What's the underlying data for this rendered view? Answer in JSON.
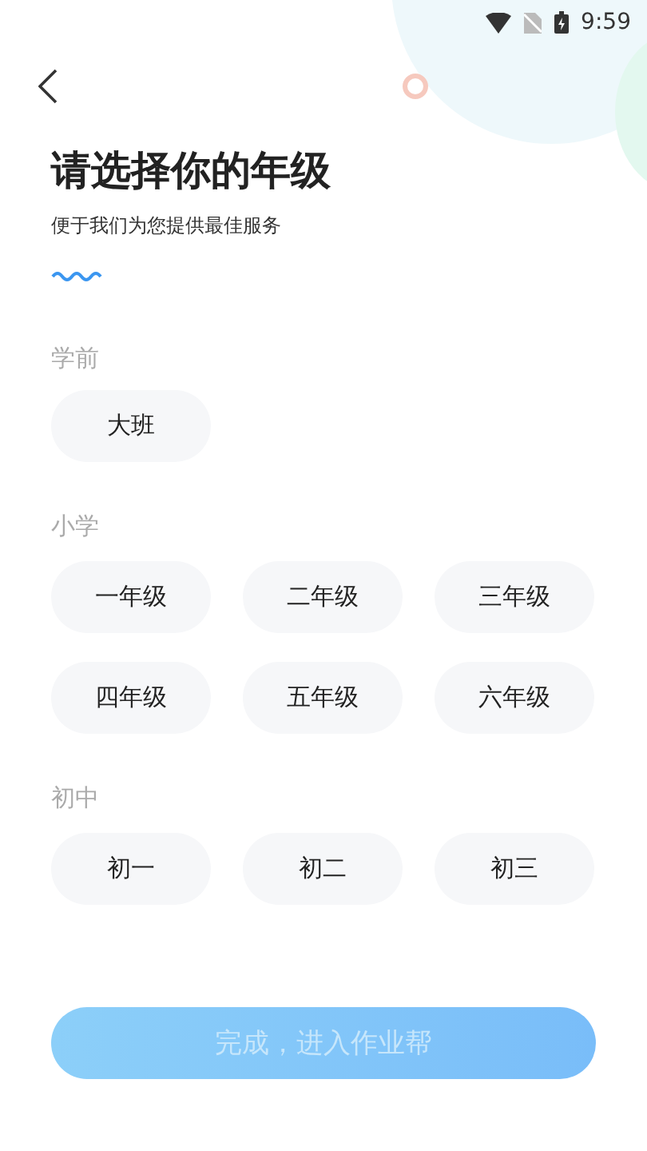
{
  "status_bar": {
    "time": "9:59"
  },
  "header": {
    "title": "请选择你的年级",
    "subtitle": "便于我们为您提供最佳服务"
  },
  "sections": [
    {
      "label": "学前",
      "grades": [
        {
          "label": "大班",
          "selected": false
        }
      ]
    },
    {
      "label": "小学",
      "grades": [
        {
          "label": "一年级",
          "selected": false
        },
        {
          "label": "二年级",
          "selected": false
        },
        {
          "label": "三年级",
          "selected": false
        },
        {
          "label": "四年级",
          "selected": false
        },
        {
          "label": "五年级",
          "selected": false
        },
        {
          "label": "六年级",
          "selected": false
        }
      ]
    },
    {
      "label": "初中",
      "grades": [
        {
          "label": "初一",
          "selected": false
        },
        {
          "label": "初二",
          "selected": false
        },
        {
          "label": "初三",
          "selected": false
        }
      ]
    }
  ],
  "confirm_button": {
    "label": "完成，进入作业帮",
    "disabled": true
  }
}
